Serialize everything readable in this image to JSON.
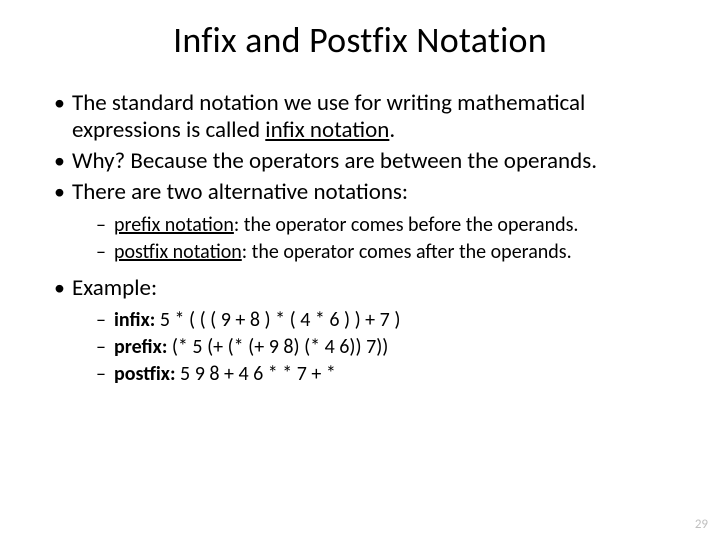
{
  "title": "Infix and Postfix Notation",
  "bullets": {
    "b1_a": "The standard notation we use for writing mathematical expressions is called ",
    "b1_b": "infix notation",
    "b1_c": ".",
    "b2": "Why? Because the operators are between the operands.",
    "b3": "There are two alternative notations:",
    "b3_sub": {
      "s1_a": "prefix notation",
      "s1_b": ": the operator comes before the operands.",
      "s2_a": "postfix notation",
      "s2_b": ": the operator comes after the operands."
    },
    "b4": "Example:",
    "b4_sub": {
      "s1_a": "infix:",
      "s1_b": "   5 * ( ( ( 9 + 8 ) *  ( 4 * 6 ) ) + 7 )",
      "s2_a": "prefix:",
      "s2_b": "   (* 5 (+ (* (+ 9 8) (* 4 6)) 7))",
      "s3_a": "postfix:",
      "s3_b": "   5 9 8 + 4 6 * * 7 + *"
    }
  },
  "page_number": "29"
}
